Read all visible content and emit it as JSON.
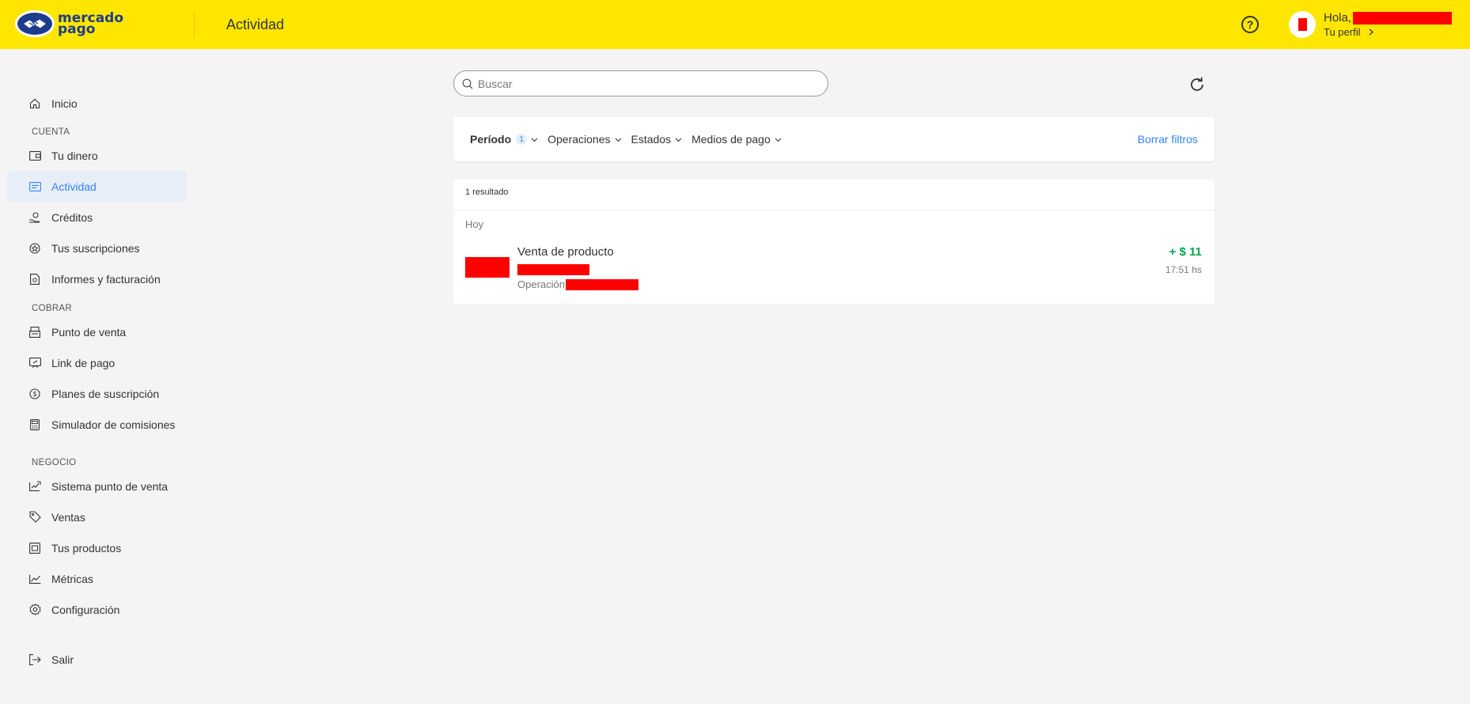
{
  "header": {
    "logo_line1": "mercado",
    "logo_line2": "pago",
    "title": "Actividad",
    "help_icon": "question-circle-icon",
    "greeting": "Hola,",
    "profile_link": "Tu perfil",
    "accent_color": "#ffe600"
  },
  "sidebar": {
    "top_item": {
      "label": "Inicio",
      "icon": "home-icon"
    },
    "sections": [
      {
        "title": "CUENTA",
        "items": [
          {
            "label": "Tu dinero",
            "icon": "wallet-icon"
          },
          {
            "label": "Actividad",
            "icon": "activity-icon",
            "active": true
          },
          {
            "label": "Créditos",
            "icon": "credits-icon"
          },
          {
            "label": "Tus suscripciones",
            "icon": "subscriptions-icon"
          },
          {
            "label": "Informes y facturación",
            "icon": "reports-icon"
          }
        ]
      },
      {
        "title": "COBRAR",
        "items": [
          {
            "label": "Punto de venta",
            "icon": "pos-icon"
          },
          {
            "label": "Link de pago",
            "icon": "payment-link-icon"
          },
          {
            "label": "Planes de suscripción",
            "icon": "plans-icon"
          },
          {
            "label": "Simulador de comisiones",
            "icon": "calculator-icon"
          }
        ]
      },
      {
        "title": "NEGOCIO",
        "items": [
          {
            "label": "Sistema punto de venta",
            "icon": "pos-system-icon"
          },
          {
            "label": "Ventas",
            "icon": "tag-icon"
          },
          {
            "label": "Tus productos",
            "icon": "products-icon"
          },
          {
            "label": "Métricas",
            "icon": "metrics-icon"
          },
          {
            "label": "Configuración",
            "icon": "gear-icon"
          }
        ]
      }
    ],
    "logout": {
      "label": "Salir",
      "icon": "logout-icon"
    }
  },
  "main": {
    "search": {
      "placeholder": "Buscar"
    },
    "refresh_icon": "refresh-icon",
    "filters": {
      "items": [
        {
          "label": "Período",
          "count": "1"
        },
        {
          "label": "Operaciones"
        },
        {
          "label": "Estados"
        },
        {
          "label": "Medios de pago"
        }
      ],
      "clear_label": "Borrar filtros"
    },
    "results": {
      "count_label": "1 resultado",
      "date_group": "Hoy",
      "transactions": [
        {
          "title": "Venta de producto",
          "operation_label": "Operación",
          "amount": "+ $ 11",
          "time": "17:51 hs"
        }
      ]
    }
  }
}
